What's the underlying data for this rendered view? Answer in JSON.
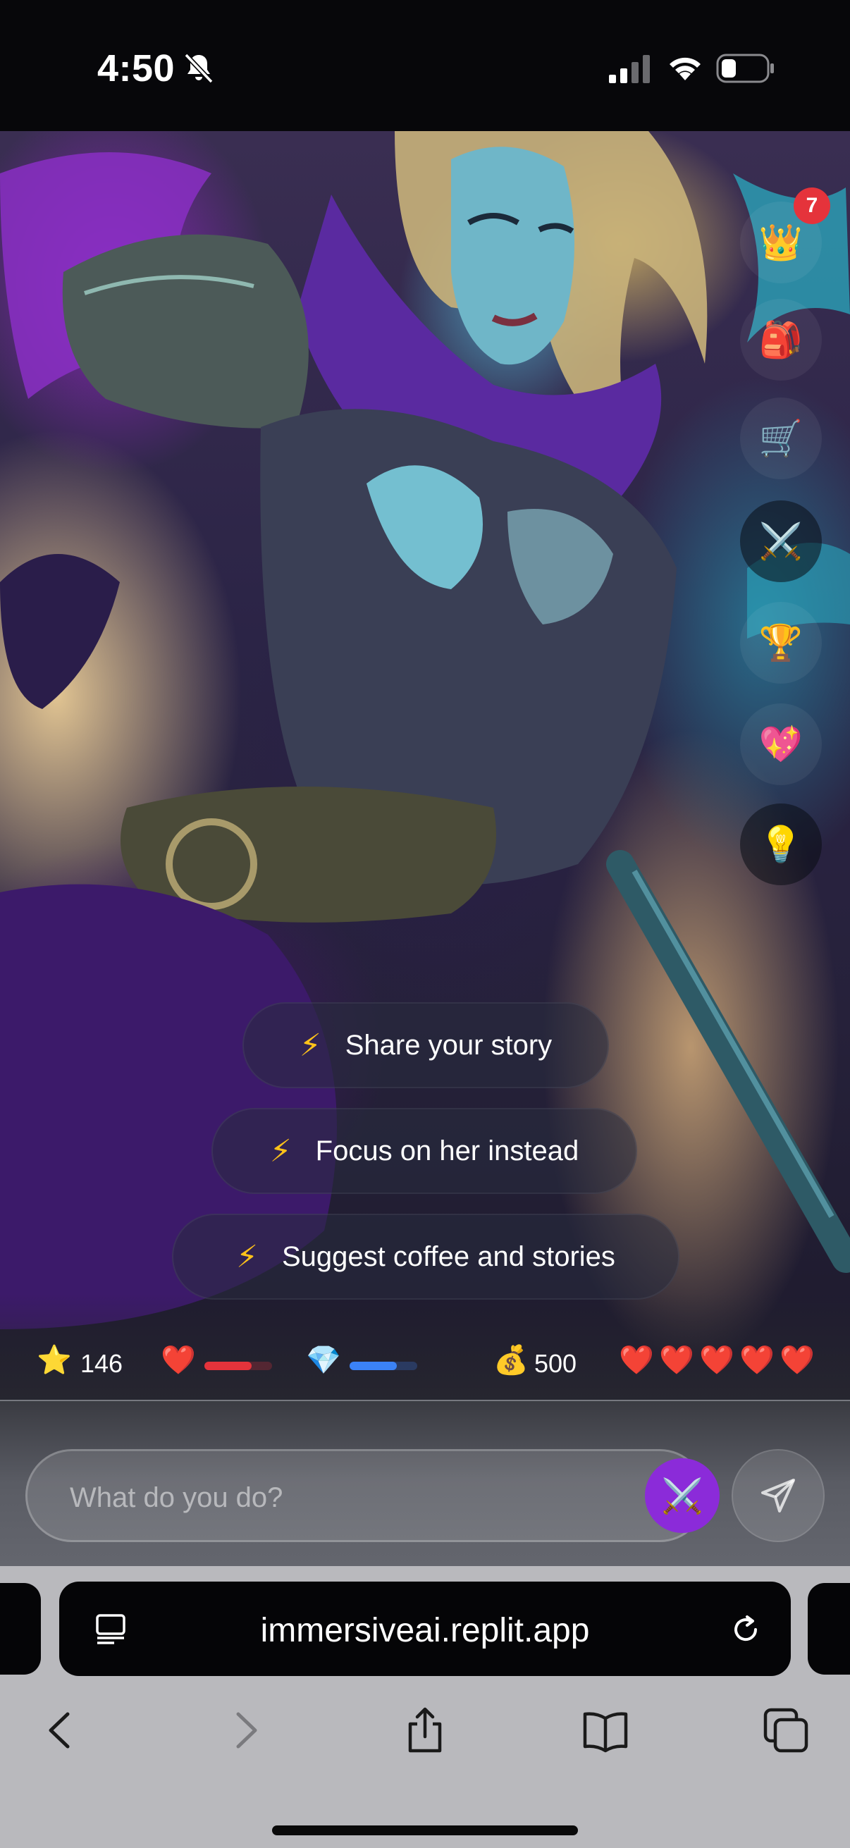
{
  "status_bar": {
    "time": "4:50",
    "icons": [
      "bell-slash-icon",
      "cellular-signal-icon",
      "wifi-icon",
      "battery-icon"
    ]
  },
  "side_actions": [
    {
      "name": "crown-button",
      "emoji": "👑",
      "badge": "7"
    },
    {
      "name": "backpack-button",
      "emoji": "🎒"
    },
    {
      "name": "shop-cart-button",
      "emoji": "🛒"
    },
    {
      "name": "battle-button",
      "emoji": "⚔️"
    },
    {
      "name": "trophy-button",
      "emoji": "🏆"
    },
    {
      "name": "relationship-heart-button",
      "emoji": "💖"
    },
    {
      "name": "hint-lightbulb-button",
      "emoji": "💡"
    }
  ],
  "suggestions": [
    {
      "bolt": "⚡",
      "label": "Share your story"
    },
    {
      "bolt": "⚡",
      "label": "Focus on her instead"
    },
    {
      "bolt": "⚡",
      "label": "Suggest coffee and stories"
    }
  ],
  "stats": {
    "xp_emoji": "⭐",
    "xp": "146",
    "health_emoji": "❤️",
    "health_level": 0.7,
    "health_color": "#e5333b",
    "mana_emoji": "💎",
    "mana_level": 0.7,
    "mana_color": "#3b82f6",
    "gold_emoji": "💰",
    "gold": "500",
    "lives": [
      "❤️",
      "❤️",
      "❤️",
      "❤️",
      "❤️"
    ]
  },
  "composer": {
    "placeholder": "What do you do?",
    "action_emoji": "⚔️",
    "accent": "#8b2bd9"
  },
  "browser": {
    "url": "immersiveai.replit.app"
  }
}
